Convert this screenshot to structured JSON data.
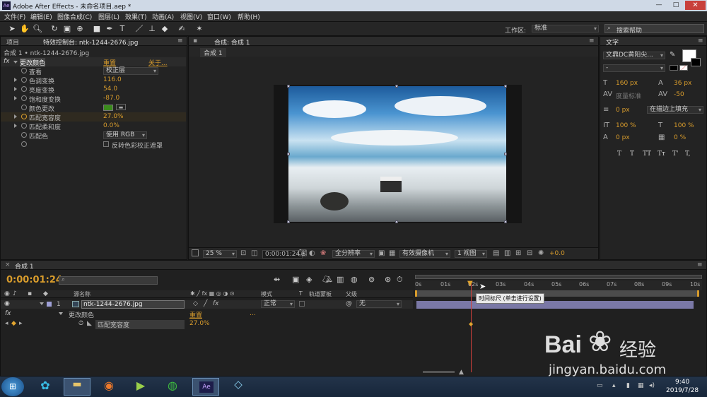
{
  "window": {
    "title": "Adobe After Effects - 未命名项目.aep *",
    "app_icon": "Ae"
  },
  "menu": [
    "文件(F)",
    "编辑(E)",
    "图像合成(C)",
    "图层(L)",
    "效果(T)",
    "动画(A)",
    "视图(V)",
    "窗口(W)",
    "帮助(H)"
  ],
  "workspace": {
    "label": "工作区:",
    "value": "标准"
  },
  "search_help": "搜索帮助",
  "left_panel": {
    "tab_project": "项目",
    "tab_effects": "特效控制台: ntk-1244-2676.jpg",
    "breadcrumb": "合成 1 • ntk-1244-2676.jpg",
    "effect_name": "更改颜色",
    "reset": "重置",
    "about": "关于...",
    "props": [
      {
        "label": "查看",
        "value": "校正层",
        "kind": "dropdown"
      },
      {
        "label": "色调变换",
        "value": "116.0",
        "kind": "number"
      },
      {
        "label": "亮度变换",
        "value": "54.0",
        "kind": "number"
      },
      {
        "label": "饱和度变换",
        "value": "-87.0",
        "kind": "number"
      },
      {
        "label": "颜色更改",
        "value": "",
        "kind": "color"
      },
      {
        "label": "匹配宽容度",
        "value": "27.0%",
        "kind": "number"
      },
      {
        "label": "匹配柔和度",
        "value": "0.0%",
        "kind": "number"
      },
      {
        "label": "匹配色",
        "value": "使用 RGB",
        "kind": "dropdown"
      },
      {
        "label": "",
        "value": "反转色彩校正遮罩",
        "kind": "checkbox"
      }
    ],
    "swatch_color": "#3a8a1c"
  },
  "comp_panel": {
    "tab": "合成: 合成 1",
    "subtab": "合成 1",
    "zoom": "25 %",
    "timecode": "0:00:01:24",
    "resolution": "全分辨率",
    "camera": "有效摄像机",
    "views": "1 视图",
    "exposure": "+0.0"
  },
  "text_panel": {
    "title": "文字",
    "font": "文鼎DC黄阳尖...",
    "style": "-",
    "size": "160 px",
    "leading": "36 px",
    "kerning": "度量标准",
    "tracking": "-50",
    "stroke_width": "0 px",
    "stroke_type": "在描边上填充",
    "vscale": "100 %",
    "hscale": "100 %",
    "baseline": "0 px",
    "tsume": "0 %",
    "styles": [
      "T",
      "T",
      "TT",
      "Tт",
      "T'",
      "T,"
    ]
  },
  "timeline": {
    "tab": "合成 1",
    "timecode": "0:00:01:24",
    "search_placeholder": "",
    "col_source": "源名称",
    "col_mode": "模式",
    "col_t": "T",
    "col_trkmat": "轨道蒙板",
    "col_parent": "父级",
    "layer_num": "1",
    "layer_name": "ntk-1244-2676.jpg",
    "layer_mode": "正常",
    "layer_parent": "无",
    "effect_row": "更改颜色",
    "effect_reset": "重置",
    "effect_dots": "...",
    "prop_row": "匹配宽容度",
    "prop_value": "27.0%",
    "ruler": [
      "0s",
      "01s",
      "02s",
      "03s",
      "04s",
      "05s",
      "06s",
      "07s",
      "08s",
      "09s",
      "10s"
    ],
    "tooltip": "时间标尺 (单击进行设置)"
  },
  "taskbar": {
    "time": "9:40",
    "date": "2019/7/28",
    "ae": "Ae"
  },
  "watermark": {
    "brand": "Bai",
    "brand_cn": "经验",
    "url": "jingyan.baidu.com"
  }
}
